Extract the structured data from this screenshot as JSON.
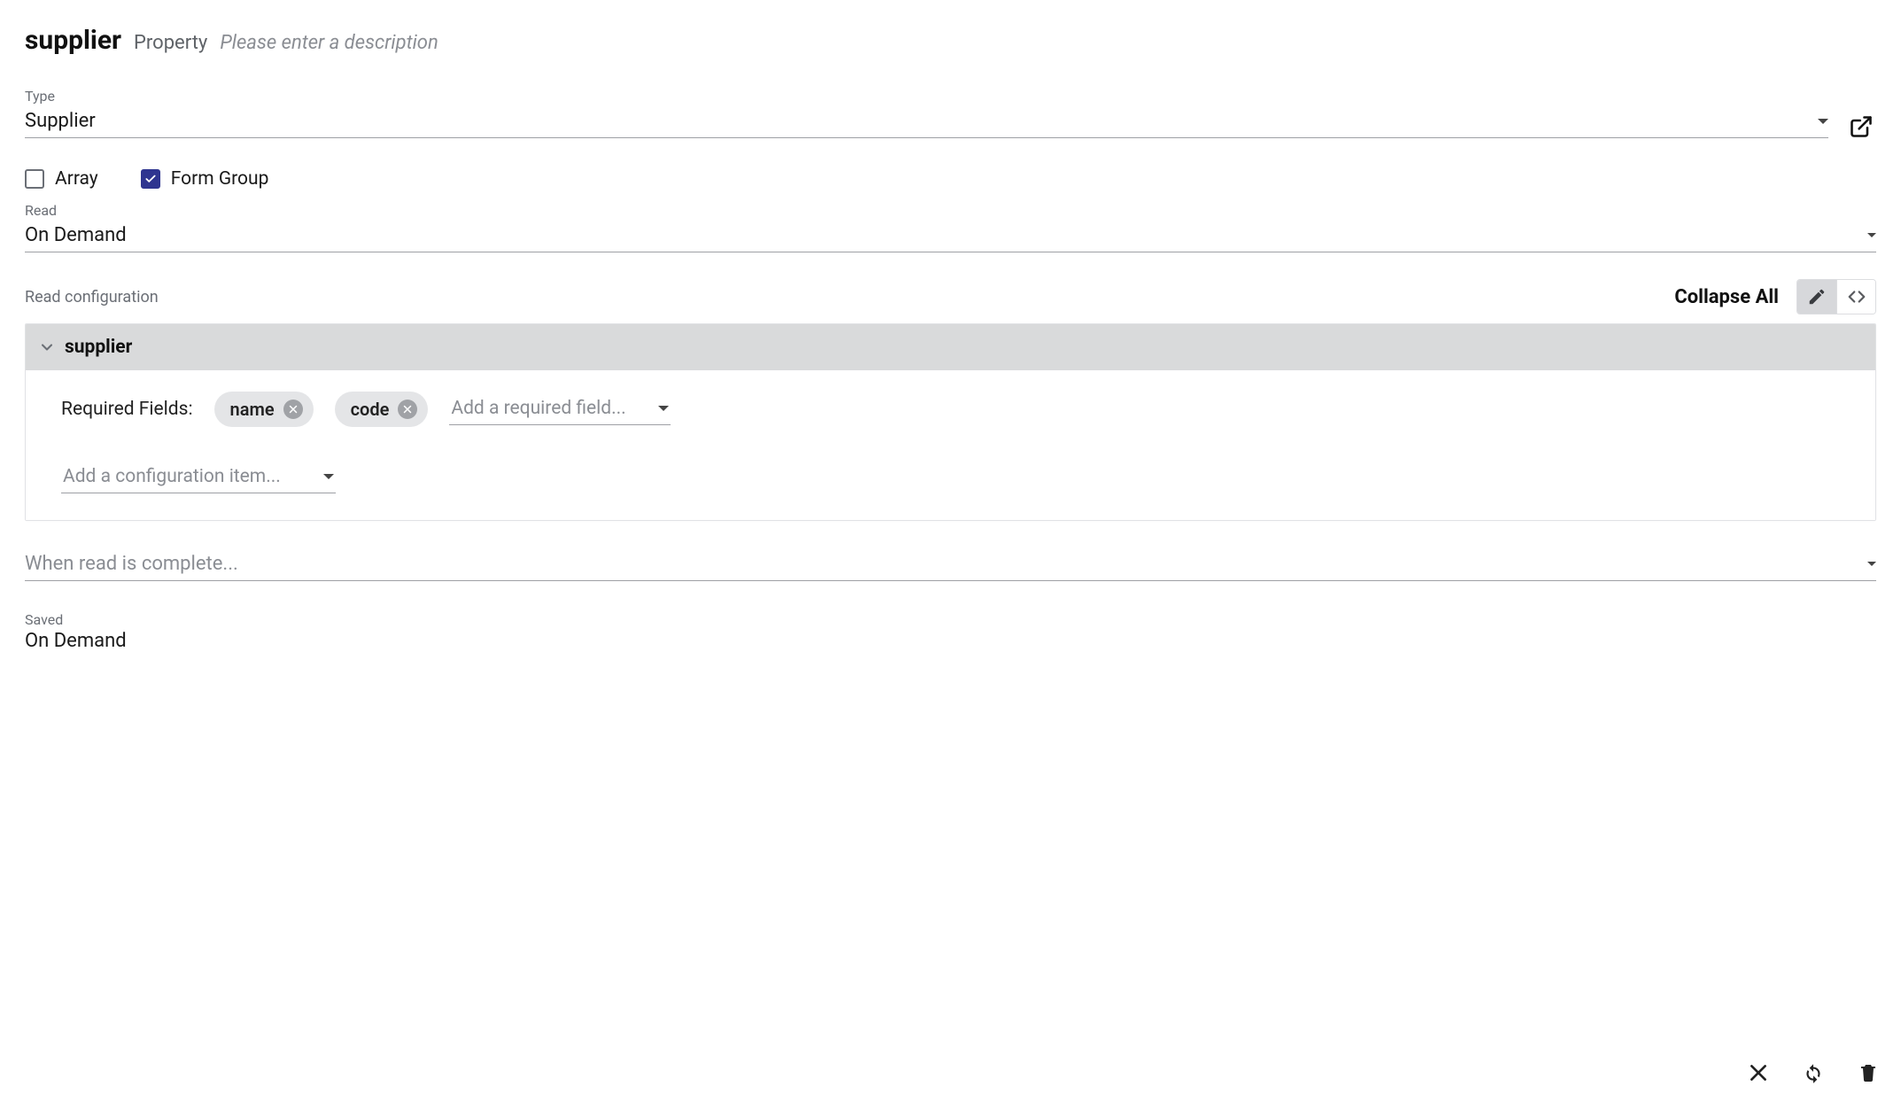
{
  "header": {
    "title": "supplier",
    "kind": "Property",
    "description_placeholder": "Please enter a description"
  },
  "type": {
    "label": "Type",
    "value": "Supplier"
  },
  "checkboxes": {
    "array": {
      "label": "Array",
      "checked": false
    },
    "form_group": {
      "label": "Form Group",
      "checked": true
    }
  },
  "read": {
    "label": "Read",
    "value": "On Demand"
  },
  "read_config": {
    "label": "Read configuration",
    "collapse_all": "Collapse All",
    "tree_root": "supplier",
    "required_fields_label": "Required Fields:",
    "required_fields": [
      "name",
      "code"
    ],
    "add_required_placeholder": "Add a required field...",
    "add_config_item_placeholder": "Add a configuration item..."
  },
  "when_read_complete": {
    "placeholder": "When read is complete..."
  },
  "saved": {
    "label": "Saved",
    "value": "On Demand"
  }
}
